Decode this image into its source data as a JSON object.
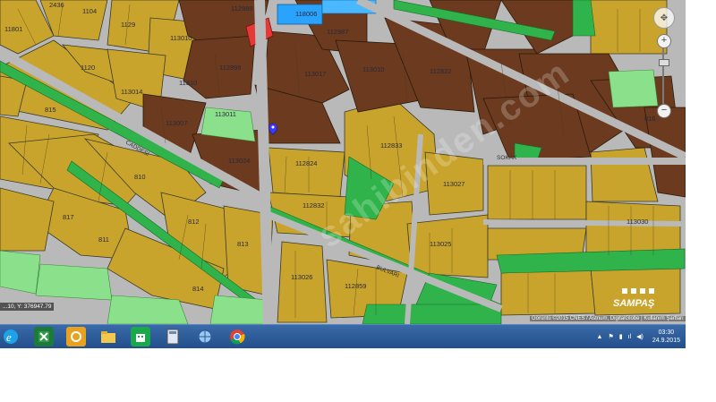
{
  "map": {
    "watermark": "sahibinden.com",
    "attribution": "Görüntü ©2015 CNES / Astrium, DigitalGlobe | Kullanım Şartları",
    "coordinate_readout": "...10, Y: 376947.79",
    "logo_text": "SAMPAŞ",
    "block_labels": [
      "2436",
      "1104",
      "11801",
      "1129",
      "113010",
      "112988",
      "118006",
      "112987",
      "112898",
      "11310",
      "113017",
      "113010",
      "113011",
      "113014",
      "1120",
      "112822",
      "113007",
      "113024",
      "112824",
      "112833",
      "112832",
      "113027",
      "113025",
      "113026",
      "112859",
      "113030",
      "816",
      "815",
      "817",
      "810",
      "811",
      "812",
      "813",
      "814"
    ],
    "road_labels": [
      "CADDESİ",
      "SOKAK",
      "BULVARI"
    ],
    "colors": {
      "residential": "#c9a42c",
      "commercial": "#6b3a1f",
      "green": "#2fb34a",
      "park": "#8be08b",
      "road": "#b9b9b9",
      "blue_parcel": "#2aa3ff",
      "red_parcel": "#e53935"
    }
  },
  "zoom": {
    "in_label": "+",
    "out_label": "−",
    "compass": "✥"
  },
  "taskbar": {
    "icons": [
      "internet-explorer-icon",
      "excel-icon",
      "outlook-icon",
      "file-explorer-icon",
      "store-icon",
      "calculator-icon",
      "network-icon",
      "chrome-icon"
    ],
    "tray": {
      "time": "03:30",
      "date": "24.9.2015"
    }
  }
}
